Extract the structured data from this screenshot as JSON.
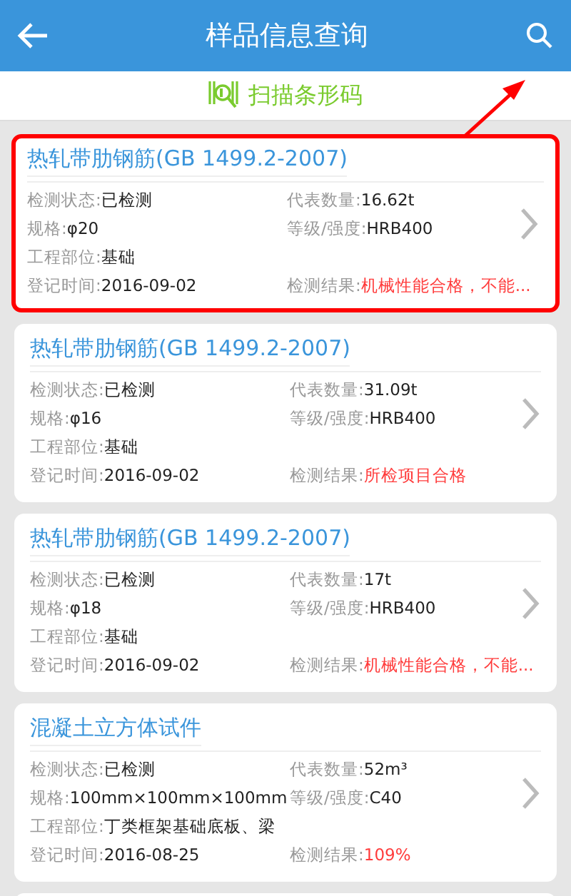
{
  "header": {
    "title": "样品信息查询"
  },
  "scan_bar": {
    "label": "扫描条形码"
  },
  "cards": [
    {
      "title": "热轧带肋钢筋(GB 1499.2-2007)",
      "highlighted": true,
      "rows": [
        [
          {
            "label": "检测状态:",
            "value": "已检测"
          },
          {
            "label": "代表数量:",
            "value": "16.62t"
          }
        ],
        [
          {
            "label": "规格:",
            "value": "φ20"
          },
          {
            "label": "等级/强度:",
            "value": "HRB400"
          }
        ],
        [
          {
            "label": "工程部位:",
            "value": "基础"
          }
        ],
        [
          {
            "label": "登记时间:",
            "value": "2016-09-02"
          },
          {
            "label": "检测结果:",
            "value": "机械性能合格，不能...",
            "alert": true
          }
        ]
      ]
    },
    {
      "title": "热轧带肋钢筋(GB 1499.2-2007)",
      "highlighted": false,
      "rows": [
        [
          {
            "label": "检测状态:",
            "value": "已检测"
          },
          {
            "label": "代表数量:",
            "value": "31.09t"
          }
        ],
        [
          {
            "label": "规格:",
            "value": "φ16"
          },
          {
            "label": "等级/强度:",
            "value": "HRB400"
          }
        ],
        [
          {
            "label": "工程部位:",
            "value": "基础"
          }
        ],
        [
          {
            "label": "登记时间:",
            "value": "2016-09-02"
          },
          {
            "label": "检测结果:",
            "value": "所检项目合格",
            "alert": true
          }
        ]
      ]
    },
    {
      "title": "热轧带肋钢筋(GB 1499.2-2007)",
      "highlighted": false,
      "rows": [
        [
          {
            "label": "检测状态:",
            "value": "已检测"
          },
          {
            "label": "代表数量:",
            "value": "17t"
          }
        ],
        [
          {
            "label": "规格:",
            "value": "φ18"
          },
          {
            "label": "等级/强度:",
            "value": "HRB400"
          }
        ],
        [
          {
            "label": "工程部位:",
            "value": "基础"
          }
        ],
        [
          {
            "label": "登记时间:",
            "value": "2016-09-02"
          },
          {
            "label": "检测结果:",
            "value": "机械性能合格，不能...",
            "alert": true
          }
        ]
      ]
    },
    {
      "title": "混凝土立方体试件",
      "highlighted": false,
      "rows": [
        [
          {
            "label": "检测状态:",
            "value": "已检测"
          },
          {
            "label": "代表数量:",
            "value": "52m³"
          }
        ],
        [
          {
            "label": "规格:",
            "value": "100mm×100mm×100mm"
          },
          {
            "label": "等级/强度:",
            "value": "C40"
          }
        ],
        [
          {
            "label": "工程部位:",
            "value": "丁类框架基础底板、梁"
          }
        ],
        [
          {
            "label": "登记时间:",
            "value": "2016-08-25"
          },
          {
            "label": "检测结果:",
            "value": "109%",
            "alert": true
          }
        ]
      ]
    }
  ],
  "annotation_arrow": true
}
